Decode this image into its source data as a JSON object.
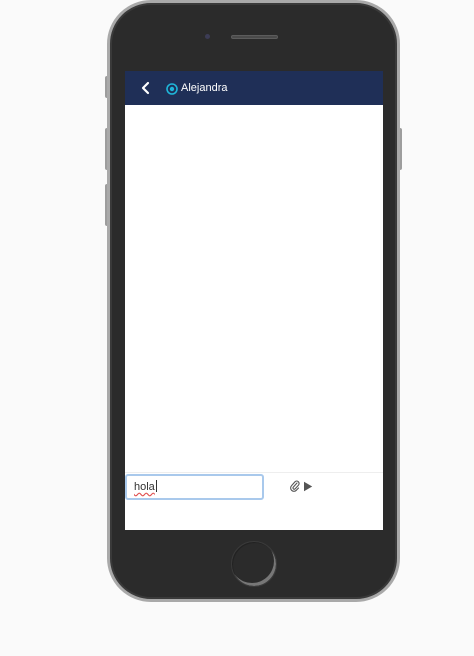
{
  "header": {
    "contact_name": "Alejandra",
    "background_color": "#1f2f57",
    "status_color": "#1fb5d9",
    "back_icon": "chevron-left-icon",
    "status_icon": "online-ring-icon"
  },
  "composer": {
    "input_value": "hola",
    "attach_icon": "paperclip-icon",
    "send_icon": "play-send-icon",
    "input_border_color": "#a9c9ec"
  }
}
